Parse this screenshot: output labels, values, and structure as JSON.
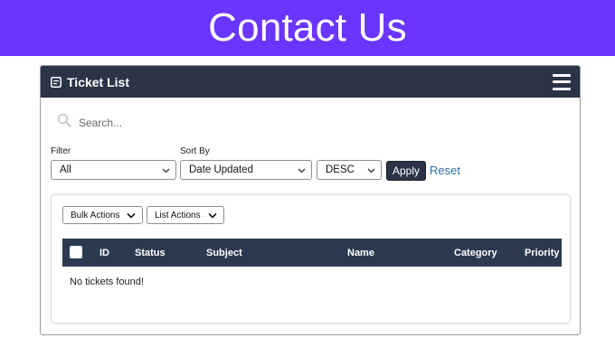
{
  "hero": {
    "title": "Contact Us",
    "background": "#6a35ff"
  },
  "panel": {
    "title": "Ticket List",
    "header_color": "#2b3347",
    "icons": {
      "title_icon": "ticket-list-icon",
      "menu_icon": "hamburger-menu-icon"
    }
  },
  "search": {
    "placeholder": "Search...",
    "value": "",
    "icon": "search-icon"
  },
  "filters": {
    "filter_label": "Filter",
    "filter_value": "All",
    "sort_label": "Sort By",
    "sort_value": "Date Updated",
    "order_value": "DESC",
    "apply_label": "Apply",
    "reset_label": "Reset"
  },
  "actions": {
    "bulk_label": "Bulk Actions",
    "list_label": "List Actions"
  },
  "table": {
    "columns": [
      "ID",
      "Status",
      "Subject",
      "Name",
      "Category",
      "Priority"
    ],
    "empty_message": "No tickets found!",
    "header_color": "#2b3a51"
  },
  "colors": {
    "link": "#2f6fa6"
  }
}
